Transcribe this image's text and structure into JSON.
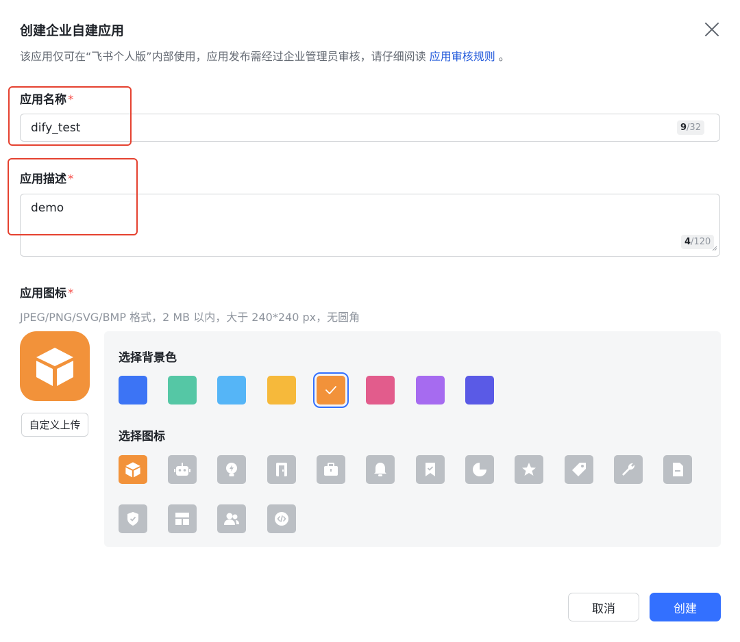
{
  "dialog": {
    "title": "创建企业自建应用",
    "subtitle_text": "该应用仅可在“飞书个人版”内部使用，应用发布需经过企业管理员审核，请仔细阅读",
    "subtitle_link": "应用审核规则",
    "subtitle_end": " 。"
  },
  "name_field": {
    "label": "应用名称",
    "required_mark": "*",
    "value": "dify_test",
    "count": "9",
    "max": "/32"
  },
  "desc_field": {
    "label": "应用描述",
    "required_mark": "*",
    "value": "demo",
    "count": "4",
    "max": "/120"
  },
  "icon_field": {
    "label": "应用图标",
    "required_mark": "*",
    "hint": "JPEG/PNG/SVG/BMP 格式，2 MB 以内，大于 240*240 px，无圆角",
    "upload_label": "自定义上传"
  },
  "picker": {
    "bg_title": "选择背景色",
    "icon_title": "选择图标",
    "colors": [
      "#3c74f5",
      "#55c7a5",
      "#55b5f7",
      "#f6b93b",
      "#f2923a",
      "#e25c8c",
      "#a66bf0",
      "#5a5ae6"
    ],
    "selected_color_index": 4,
    "icons": [
      "box-icon",
      "robot-icon",
      "bulb-icon",
      "door-icon",
      "briefcase-icon",
      "bell-icon",
      "bookmark-icon",
      "pie-icon",
      "star-icon",
      "tag-icon",
      "wrench-icon",
      "document-icon",
      "shield-icon",
      "layout-icon",
      "users-icon",
      "code-icon"
    ],
    "selected_icon_index": 0
  },
  "footer": {
    "cancel_label": "取消",
    "create_label": "创建"
  },
  "colors": {
    "primary": "#3370ff",
    "required": "#f54a45",
    "link": "#245bdb",
    "highlight_border": "#e5412f"
  }
}
